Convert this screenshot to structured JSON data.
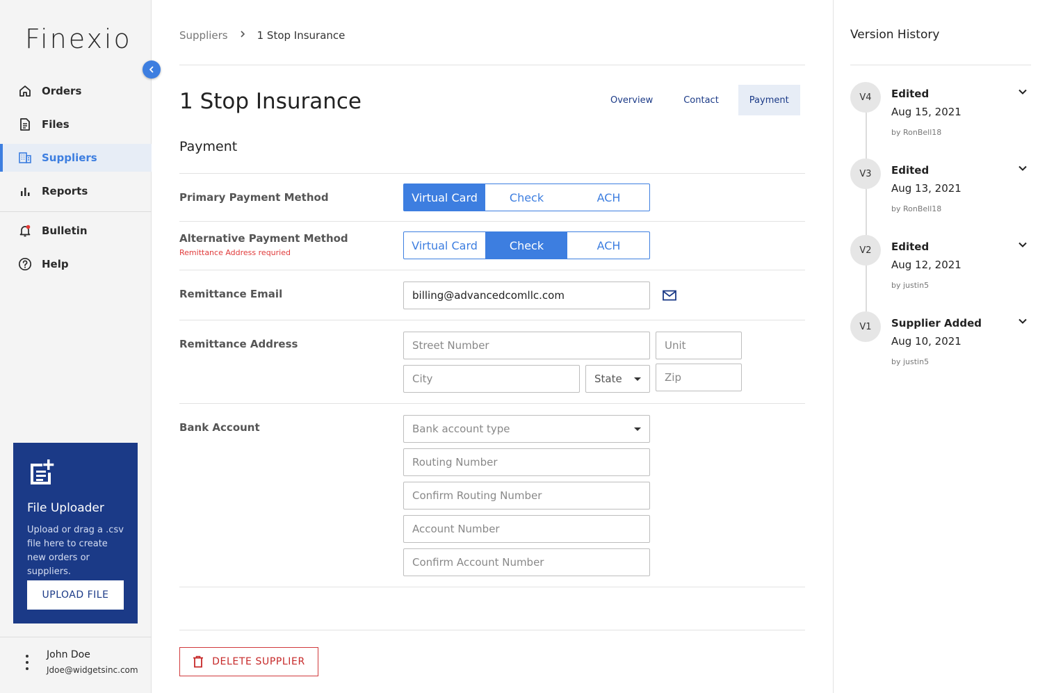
{
  "sidebar": {
    "logo": "Finexio",
    "nav": [
      {
        "label": "Orders",
        "icon": "home-icon"
      },
      {
        "label": "Files",
        "icon": "file-icon"
      },
      {
        "label": "Suppliers",
        "icon": "building-icon",
        "active": true
      },
      {
        "label": "Reports",
        "icon": "bar-chart-icon"
      },
      {
        "label": "Bulletin",
        "icon": "bell-icon"
      },
      {
        "label": "Help",
        "icon": "help-icon"
      }
    ],
    "uploader": {
      "title": "File Uploader",
      "description": "Upload or drag a .csv file here to create new orders or suppliers.",
      "button": "UPLOAD FILE"
    },
    "user": {
      "name": "John Doe",
      "email": "Jdoe@widgetsinc.com"
    }
  },
  "breadcrumb": {
    "parent": "Suppliers",
    "current": "1 Stop Insurance"
  },
  "page_title": "1 Stop Insurance",
  "tabs": [
    {
      "label": "Overview"
    },
    {
      "label": "Contact"
    },
    {
      "label": "Payment",
      "active": true
    }
  ],
  "section_title": "Payment",
  "primary_payment": {
    "label": "Primary Payment Method",
    "options": [
      "Virtual Card",
      "Check",
      "ACH"
    ],
    "selected": "Virtual Card"
  },
  "alternative_payment": {
    "label": "Alternative Payment Method",
    "note": "Remittance Address requried",
    "options": [
      "Virtual Card",
      "Check",
      "ACH"
    ],
    "selected": "Check"
  },
  "remittance_email": {
    "label": "Remittance Email",
    "value": "billing@advancedcomllc.com"
  },
  "remittance_address": {
    "label": "Remittance Address",
    "street_placeholder": "Street Number",
    "unit_placeholder": "Unit",
    "city_placeholder": "City",
    "state_placeholder": "State",
    "zip_placeholder": "Zip"
  },
  "bank_account": {
    "label": "Bank Account",
    "type_placeholder": "Bank account type",
    "routing_placeholder": "Routing Number",
    "confirm_routing_placeholder": "Confirm Routing Number",
    "account_placeholder": "Account Number",
    "confirm_account_placeholder": "Confirm Account Number"
  },
  "delete_button": "DELETE SUPPLIER",
  "version_history": {
    "title": "Version History",
    "versions": [
      {
        "badge": "V4",
        "action": "Edited",
        "date": "Aug 15, 2021",
        "by": "by RonBell18"
      },
      {
        "badge": "V3",
        "action": "Edited",
        "date": "Aug 13, 2021",
        "by": "by RonBell18"
      },
      {
        "badge": "V2",
        "action": "Edited",
        "date": "Aug 12, 2021",
        "by": "by justin5"
      },
      {
        "badge": "V1",
        "action": "Supplier Added",
        "date": "Aug 10, 2021",
        "by": "by justin5"
      }
    ]
  },
  "colors": {
    "accent": "#3d7ee0",
    "navy": "#1b3a87",
    "danger": "#c62828"
  }
}
